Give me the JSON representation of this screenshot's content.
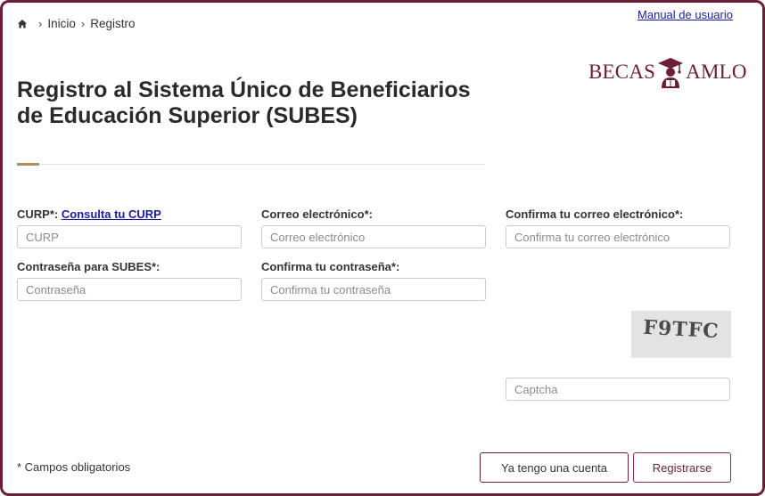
{
  "breadcrumb": {
    "icon": "home-icon",
    "items": [
      "Inicio",
      "Registro"
    ]
  },
  "header": {
    "manual_link": "Manual de usuario",
    "logo": {
      "left_text": "BECAS",
      "right_text": "AMLO",
      "icon": "graduate-cap-icon",
      "color": "#6b1e35"
    }
  },
  "page": {
    "title": "Registro al Sistema Único de Beneficiarios de Educación Superior (SUBES)",
    "accent_color": "#b38e5d"
  },
  "form": {
    "curp": {
      "label": "CURP*:",
      "link": "Consulta tu CURP",
      "placeholder": "CURP",
      "value": ""
    },
    "email": {
      "label": "Correo electrónico*:",
      "placeholder": "Correo electrónico",
      "value": ""
    },
    "email_confirm": {
      "label": "Confirma tu correo electrónico*:",
      "placeholder": "Confirma tu correo electrónico",
      "value": ""
    },
    "password": {
      "label": "Contraseña para SUBES*:",
      "placeholder": "Contraseña",
      "value": ""
    },
    "password_confirm": {
      "label": "Confirma tu contraseña*:",
      "placeholder": "Confirma tu contraseña",
      "value": ""
    },
    "captcha": {
      "image_text": "F9TFC",
      "placeholder": "Captcha",
      "value": ""
    }
  },
  "footer": {
    "required_note": "* Campos obligatorios",
    "login_button": "Ya tengo una cuenta",
    "register_button": "Registrarse"
  },
  "colors": {
    "brand": "#6b1e35",
    "link": "#1a1aa6"
  }
}
